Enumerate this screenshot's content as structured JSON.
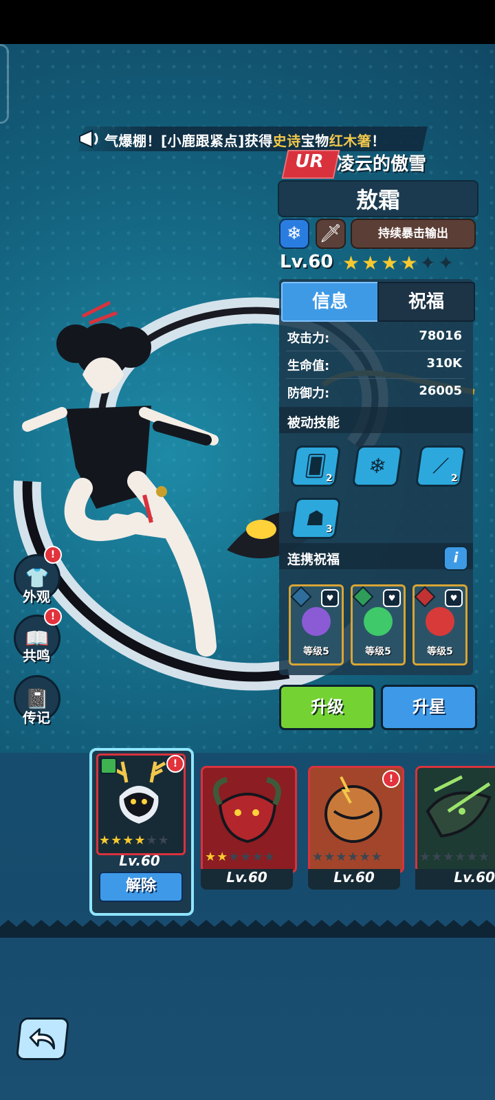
{
  "marquee": {
    "prefix": "气爆棚！[小鹿跟紧点]获得",
    "rarity_word": "史诗",
    "middle": "宝物",
    "item_name": "红木箸",
    "suffix": "！"
  },
  "hero": {
    "rarity": "UR",
    "title": "凌云的傲雪",
    "name": "敖霜",
    "element_icon": "snowflake-icon",
    "weapon_icon": "sword-icon",
    "role": "持续暴击输出",
    "level": "Lv.60",
    "stars_filled": 4,
    "stars_total": 6
  },
  "tabs": [
    {
      "label": "信息",
      "active": true
    },
    {
      "label": "祝福",
      "active": false
    }
  ],
  "stats": [
    {
      "label": "攻击力:",
      "value": "78016"
    },
    {
      "label": "生命值:",
      "value": "310K"
    },
    {
      "label": "防御力:",
      "value": "26005"
    }
  ],
  "passive": {
    "title": "被动技能",
    "skills": [
      {
        "icon": "ice-cards-icon",
        "count": "2"
      },
      {
        "icon": "snowflakes-icon",
        "count": ""
      },
      {
        "icon": "ice-shards-icon",
        "count": "2"
      },
      {
        "icon": "dragon-head-icon",
        "count": "3"
      }
    ]
  },
  "bond": {
    "title": "连携祝福",
    "info_label": "i",
    "cards": [
      {
        "art": "purple-demon-icon",
        "level": "等级5",
        "color": "#8b5bd6"
      },
      {
        "art": "green-ghost-icon",
        "level": "等级5",
        "color": "#3fc96b"
      },
      {
        "art": "red-flame-demon-icon",
        "level": "等级5",
        "color": "#d83a3a"
      }
    ]
  },
  "buttons": {
    "upgrade": "升级",
    "star_up": "升星",
    "release": "解除"
  },
  "side": {
    "appearance": "外观",
    "resonance": "共鸣",
    "biography": "传记",
    "alert": "!"
  },
  "pets": [
    {
      "level": "Lv.60",
      "stars_filled": 4,
      "stars_total": 6,
      "selected": true,
      "alert": true,
      "name_icon": "deer-spirit-icon"
    },
    {
      "level": "Lv.60",
      "stars_filled": 2,
      "stars_total": 6,
      "selected": false,
      "alert": false,
      "name_icon": "horned-beast-icon"
    },
    {
      "level": "Lv.60",
      "stars_filled": 0,
      "stars_total": 6,
      "selected": false,
      "alert": true,
      "name_icon": "pumpkin-monster-icon"
    },
    {
      "level": "Lv.60",
      "stars_filled": 0,
      "stars_total": 6,
      "selected": false,
      "alert": false,
      "name_icon": "green-dragon-icon"
    }
  ],
  "colors": {
    "gold": "#f2c84b",
    "alert_red": "#e2323c",
    "accent_blue": "#3f9ae6",
    "upgrade_green": "#74d333"
  }
}
